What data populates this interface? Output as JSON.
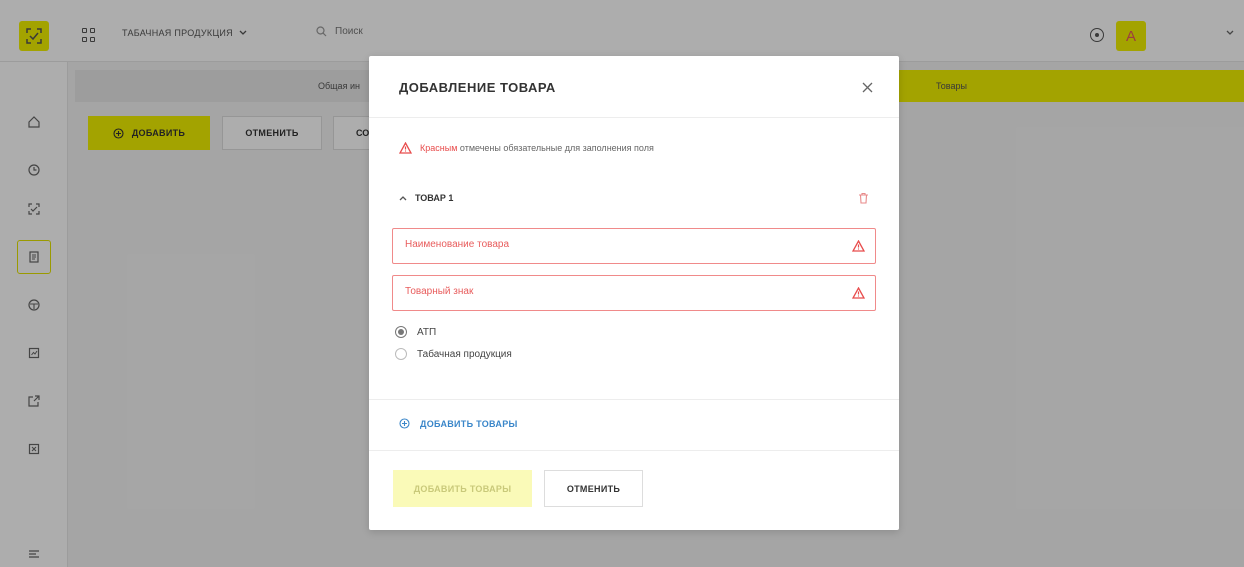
{
  "topbar": {
    "product_select_label": "ТАБАЧНАЯ ПРОДУКЦИЯ",
    "search_placeholder": "Поиск",
    "avatar_letter": "A"
  },
  "sidebar": {
    "items": [
      {
        "icon": "home-icon"
      },
      {
        "icon": "clock-icon"
      },
      {
        "icon": "scan-icon"
      },
      {
        "icon": "document-icon",
        "active": true
      },
      {
        "icon": "box-icon"
      },
      {
        "icon": "chart-icon"
      },
      {
        "icon": "export-icon"
      },
      {
        "icon": "close-square-icon"
      },
      {
        "icon": "menu-icon"
      }
    ]
  },
  "main": {
    "tab_general": "Общая ин",
    "tab_products": "Товары",
    "add_button": "ДОБАВИТЬ",
    "cancel_button": "ОТМЕНИТЬ",
    "partial_button": "СО"
  },
  "modal": {
    "title": "ДОБАВЛЕНИЕ ТОВАРА",
    "notice_red": "Красным",
    "notice_rest": "отмечены обязательные для заполнения поля",
    "item_title": "ТОВАР 1",
    "field_name_placeholder": "Наименование товара",
    "field_brand_placeholder": "Товарный знак",
    "radio_options": [
      "АТП",
      "Табачная продукция"
    ],
    "radio_selected": "АТП",
    "add_more_label": "ДОБАВИТЬ ТОВАРЫ",
    "submit_label": "ДОБАВИТЬ ТОВАРЫ",
    "cancel_label": "ОТМЕНИТЬ"
  },
  "colors": {
    "accent_yellow": "#f0f000",
    "error_red": "#e85c5c",
    "link_blue": "#3a86c9"
  }
}
